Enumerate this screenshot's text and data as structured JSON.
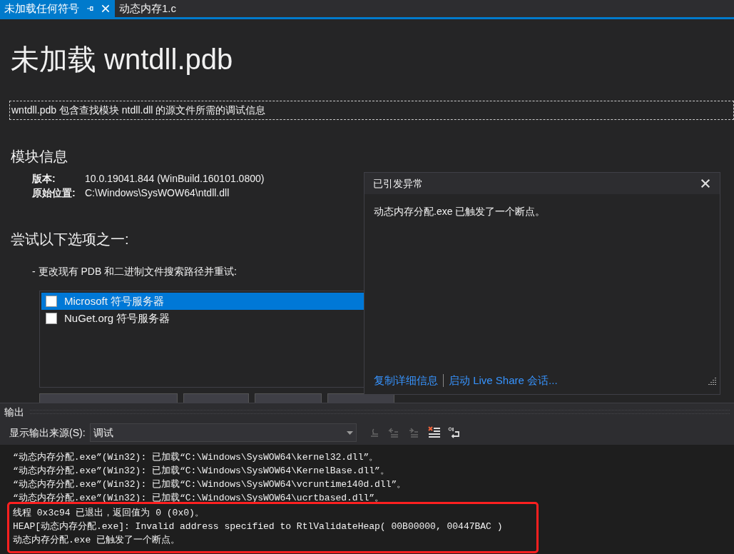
{
  "tabs": [
    {
      "label": "未加载任何符号",
      "selected": true
    },
    {
      "label": "动态内存1.c",
      "selected": false
    }
  ],
  "page": {
    "title": "未加载 wntdll.pdb",
    "description": "wntdll.pdb 包含查找模块 ntdll.dll 的源文件所需的调试信息",
    "module_heading": "模块信息",
    "fields": [
      {
        "label": "版本:",
        "value": "10.0.19041.844 (WinBuild.160101.0800)"
      },
      {
        "label": "原始位置:",
        "value": "C:\\Windows\\SysWOW64\\ntdll.dll"
      }
    ],
    "options_heading": "尝试以下选项之一:",
    "option": "-  更改现有 PDB 和二进制文件搜索路径并重试:",
    "symbol_servers": [
      {
        "label": "Microsoft 符号服务器",
        "checked": false,
        "selected": true
      },
      {
        "label": "NuGet.org 符号服务器",
        "checked": false,
        "selected": false
      }
    ]
  },
  "dialog": {
    "title": "已引发异常",
    "message": "动态内存分配.exe 已触发了一个断点。",
    "links": [
      "复制详细信息",
      "启动 Live Share 会话..."
    ]
  },
  "output": {
    "title": "输出",
    "source_label": "显示输出来源(S):",
    "source_value": "调试",
    "lines": [
      "“动态内存分配.exe”(Win32): 已加载“C:\\Windows\\SysWOW64\\kernel32.dll”。",
      "“动态内存分配.exe”(Win32): 已加载“C:\\Windows\\SysWOW64\\KernelBase.dll”。",
      "“动态内存分配.exe”(Win32): 已加载“C:\\Windows\\SysWOW64\\vcruntime140d.dll”。",
      "“动态内存分配.exe”(Win32): 已加载“C:\\Windows\\SysWOW64\\ucrtbased.dll”。"
    ],
    "highlighted_lines": [
      "线程 0x3c94 已退出，返回值为 0 (0x0)。",
      "HEAP[动态内存分配.exe]: Invalid address specified to RtlValidateHeap( 00B00000, 00447BAC )",
      "动态内存分配.exe 已触发了一个断点。"
    ]
  }
}
